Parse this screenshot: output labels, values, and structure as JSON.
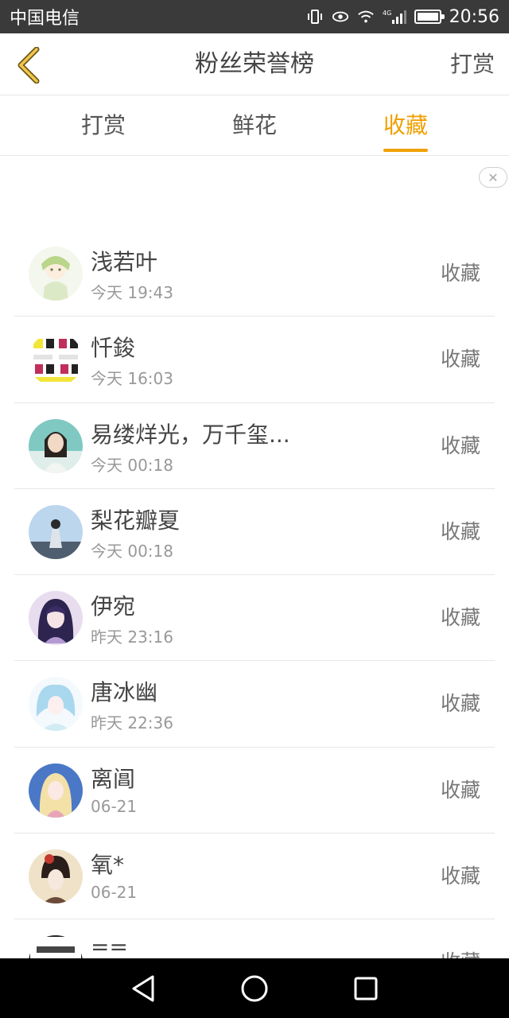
{
  "status_bar": {
    "carrier": "中国电信",
    "network": "4G",
    "time": "20:56"
  },
  "nav": {
    "title": "粉丝荣誉榜",
    "action_label": "打赏"
  },
  "tabs": [
    {
      "label": "打赏",
      "active": false
    },
    {
      "label": "鲜花",
      "active": false
    },
    {
      "label": "收藏",
      "active": true
    }
  ],
  "ad": {
    "close_label": "✕"
  },
  "fans": [
    {
      "name": "浅若叶",
      "time": "今天 19:43",
      "action": "收藏"
    },
    {
      "name": "忏鋑",
      "time": "今天 16:03",
      "action": "收藏"
    },
    {
      "name": "易缕烊光，万千玺...",
      "time": "今天 00:18",
      "action": "收藏"
    },
    {
      "name": "梨花瓣夏",
      "time": "今天 00:18",
      "action": "收藏"
    },
    {
      "name": "伊宛",
      "time": "昨天 23:16",
      "action": "收藏"
    },
    {
      "name": "唐冰幽",
      "time": "昨天 22:36",
      "action": "收藏"
    },
    {
      "name": "离阊",
      "time": "06-21",
      "action": "收藏"
    },
    {
      "name": "氧*",
      "time": "06-21",
      "action": "收藏"
    },
    {
      "name": "==",
      "time": "",
      "action": "收藏"
    }
  ],
  "colors": {
    "accent": "#f0a000",
    "status_bar_bg": "#3a3a3a",
    "system_nav_bg": "#000000"
  },
  "battery_level": 1.0
}
